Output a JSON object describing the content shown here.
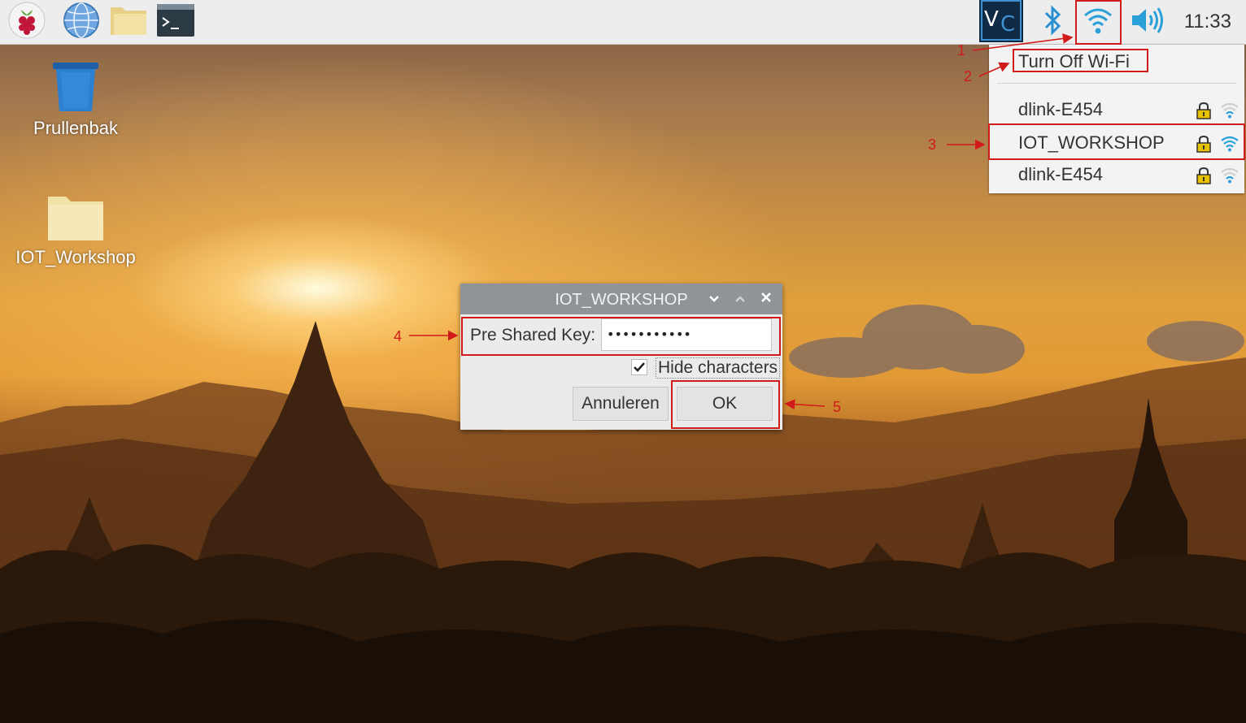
{
  "panel": {
    "clock": "11:33",
    "launchers": [
      {
        "name": "raspberry-menu-icon"
      },
      {
        "name": "web-browser-icon"
      },
      {
        "name": "file-manager-icon"
      },
      {
        "name": "terminal-icon"
      }
    ],
    "tray": [
      "vnc-icon",
      "bluetooth-icon",
      "wifi-icon",
      "volume-icon"
    ]
  },
  "desktop": {
    "icons": [
      {
        "label": "Prullenbak",
        "icon": "trash-icon"
      },
      {
        "label": "IOT_Workshop",
        "icon": "folder-icon"
      }
    ]
  },
  "wifi_menu": {
    "turn_off_label": "Turn Off Wi-Fi",
    "networks": [
      {
        "ssid": "dlink-E454",
        "locked": true,
        "signal": "weak"
      },
      {
        "ssid": "IOT_WORKSHOP",
        "locked": true,
        "signal": "strong"
      },
      {
        "ssid": "dlink-E454",
        "locked": true,
        "signal": "weak"
      }
    ]
  },
  "dialog": {
    "title": "IOT_WORKSHOP",
    "psk_label": "Pre Shared Key:",
    "psk_value": "•••••••••••",
    "hide_label": "Hide characters",
    "hide_checked": true,
    "cancel_label": "Annuleren",
    "ok_label": "OK"
  },
  "annotations": [
    "1",
    "2",
    "3",
    "4",
    "5"
  ],
  "colors": {
    "annotation": "#d11a1a",
    "wifi_blue": "#2a9fd8",
    "panel_bg": "#ededed"
  }
}
